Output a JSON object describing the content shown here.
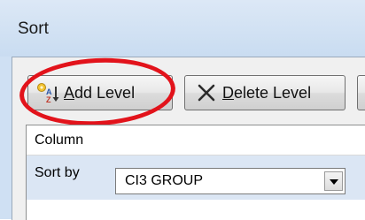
{
  "window": {
    "title": "Sort"
  },
  "toolbar": {
    "add_level": {
      "accesskey": "A",
      "rest": "dd Level",
      "icon": "add-level-icon"
    },
    "delete_level": {
      "accesskey": "D",
      "rest": "elete Level",
      "icon": "delete-x-icon"
    }
  },
  "grid": {
    "column_header": "Column",
    "rows": [
      {
        "label": "Sort by",
        "value": "CI3 GROUP"
      }
    ]
  },
  "colors": {
    "highlight_ellipse": "#e2131b",
    "row_selected": "#dbe6f4"
  }
}
